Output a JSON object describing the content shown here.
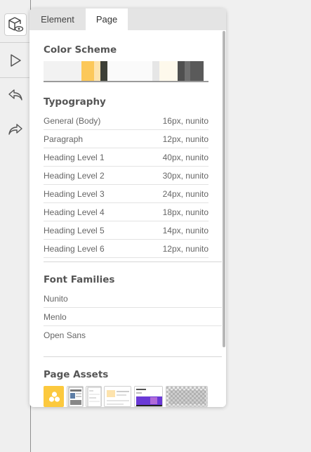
{
  "tabs": [
    {
      "label": "Element",
      "active": false
    },
    {
      "label": "Page",
      "active": true
    }
  ],
  "toolbar": {
    "icons": [
      "inspect-box-eye-icon",
      "play-icon",
      "undo-icon",
      "redo-icon"
    ]
  },
  "color_scheme": {
    "title": "Color Scheme",
    "colors": [
      "#f2f2f2",
      "#f2f2f2",
      "#fcc85a",
      "#fde3ad",
      "#3d3f37",
      "#fafafa",
      "#fafafa",
      "#e6e6e6",
      "#fef9ec",
      "#4f4f4f",
      "#6f6f6f",
      "#5a5a5a"
    ]
  },
  "typography": {
    "title": "Typography",
    "rows": [
      {
        "label": "General (Body)",
        "value": "16px, nunito"
      },
      {
        "label": "Paragraph",
        "value": "12px, nunito"
      },
      {
        "label": "Heading Level 1",
        "value": "40px, nunito"
      },
      {
        "label": "Heading Level 2",
        "value": "30px, nunito"
      },
      {
        "label": "Heading Level 3",
        "value": "24px, nunito"
      },
      {
        "label": "Heading Level 4",
        "value": "18px, nunito"
      },
      {
        "label": "Heading Level 5",
        "value": "14px, nunito"
      },
      {
        "label": "Heading Level 6",
        "value": "12px, nunito"
      }
    ]
  },
  "font_families": {
    "title": "Font Families",
    "items": [
      "Nunito",
      "Menlo",
      "Open Sans"
    ]
  },
  "page_assets": {
    "title": "Page Assets",
    "items": [
      "logo-asset",
      "mobile-screenshot-asset",
      "tablet-screenshot-asset",
      "web-screenshot-asset",
      "purple-banner-asset",
      "transparent-image-asset"
    ]
  }
}
